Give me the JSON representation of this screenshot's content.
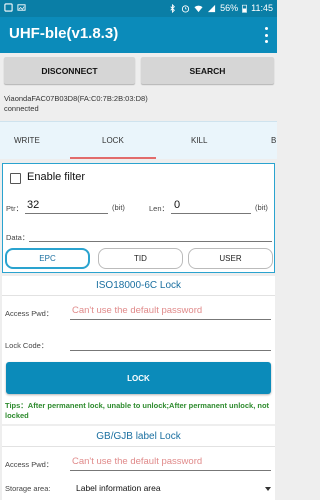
{
  "status_bar": {
    "time": "11:45",
    "battery": "56%",
    "icons": [
      "notification-icon",
      "image-icon",
      "bluetooth-icon",
      "alarm-icon",
      "wifi-icon",
      "signal-icon",
      "battery-icon"
    ]
  },
  "app_bar": {
    "title": "UHF-ble(v1.8.3)",
    "menu_icon": "overflow-menu-icon"
  },
  "actions": {
    "disconnect": "DISCONNECT",
    "search": "SEARCH"
  },
  "device": {
    "name": "ViaondaFAC07B03D8(FA:C0:7B:2B:03:D8)",
    "state": "connected"
  },
  "tabs": [
    {
      "label": "WRITE",
      "selected": false
    },
    {
      "label": "LOCK",
      "selected": true
    },
    {
      "label": "KILL",
      "selected": false
    },
    {
      "label": "B",
      "selected": false
    }
  ],
  "filter": {
    "enable_label": "Enable filter",
    "checked": false,
    "ptr_label": "Ptr：",
    "ptr_value": "32",
    "ptr_unit": "(bit)",
    "len_label": "Len：",
    "len_value": "0",
    "len_unit": "(bit)",
    "data_label": "Data：",
    "data_value": "",
    "banks": [
      "EPC",
      "TID",
      "USER"
    ],
    "selected_bank": "EPC"
  },
  "iso_lock": {
    "title": "ISO18000-6C Lock",
    "access_pwd_label": "Access Pwd：",
    "access_pwd_placeholder": "Can't use the default password",
    "lock_code_label": "Lock Code：",
    "lock_code_value": "",
    "lock_button": "LOCK",
    "tips": "Tips：After permanent lock, unable to unlock;After permanent unlock, not locked"
  },
  "gb_lock": {
    "title": "GB/GJB label Lock",
    "access_pwd_label": "Access Pwd：",
    "access_pwd_placeholder": "Can't use the default password",
    "storage_label": "Storage area:",
    "storage_value": "Label information area"
  },
  "colors": {
    "app_bar": "#0b8bba",
    "status_bar": "#0a7ea6",
    "accent": "#2aa3cf",
    "tab_indicator": "#e26b6b",
    "tips": "#2e8b2e",
    "placeholder": "#e08a8a"
  }
}
